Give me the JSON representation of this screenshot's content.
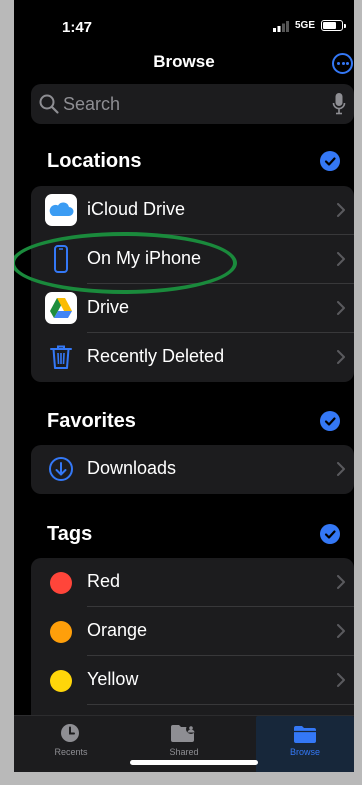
{
  "status": {
    "time": "1:47",
    "network": "5GE"
  },
  "nav": {
    "title": "Browse"
  },
  "search": {
    "placeholder": "Search"
  },
  "locations": {
    "header": "Locations",
    "items": [
      {
        "label": "iCloud Drive",
        "icon": "icloud-icon"
      },
      {
        "label": "On My iPhone",
        "icon": "iphone-icon"
      },
      {
        "label": "Drive",
        "icon": "google-drive-icon"
      },
      {
        "label": "Recently Deleted",
        "icon": "trash-icon"
      }
    ]
  },
  "favorites": {
    "header": "Favorites",
    "items": [
      {
        "label": "Downloads",
        "icon": "download-icon"
      }
    ]
  },
  "tags": {
    "header": "Tags",
    "items": [
      {
        "label": "Red",
        "color": "#ff453a"
      },
      {
        "label": "Orange",
        "color": "#ff9f0a"
      },
      {
        "label": "Yellow",
        "color": "#ffd60a"
      }
    ]
  },
  "tabbar": {
    "tabs": [
      {
        "label": "Recents",
        "icon": "clock-icon"
      },
      {
        "label": "Shared",
        "icon": "shared-folder-icon"
      },
      {
        "label": "Browse",
        "icon": "folder-icon",
        "active": true
      }
    ]
  },
  "colors": {
    "accent": "#3478f6",
    "background": "#000000",
    "cell": "#1c1c1e",
    "annotation": "#1a8a3c"
  }
}
